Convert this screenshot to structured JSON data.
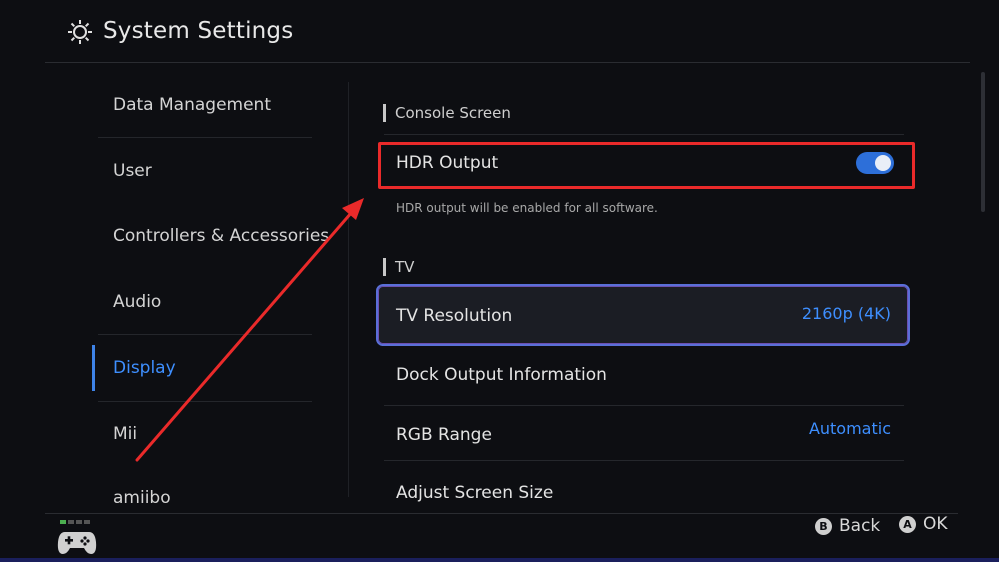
{
  "header": {
    "title": "System Settings",
    "icon": "gear-icon"
  },
  "sidebar": {
    "items": [
      {
        "label": "Data Management"
      },
      {
        "label": "User"
      },
      {
        "label": "Controllers & Accessories"
      },
      {
        "label": "Audio"
      },
      {
        "label": "Display",
        "selected": true
      },
      {
        "label": "Mii"
      },
      {
        "label": "amiibo"
      }
    ]
  },
  "content": {
    "console_section": "Console Screen",
    "hdr": {
      "label": "HDR Output",
      "enabled": true,
      "description": "HDR output will be enabled for all software."
    },
    "tv_section": "TV",
    "rows": [
      {
        "label": "TV Resolution",
        "value": "2160p (4K)"
      },
      {
        "label": "Dock Output Information",
        "value": ""
      },
      {
        "label": "RGB Range",
        "value": "Automatic"
      },
      {
        "label": "Adjust Screen Size",
        "value": ""
      }
    ]
  },
  "footer": {
    "back": {
      "glyph": "B",
      "label": "Back"
    },
    "ok": {
      "glyph": "A",
      "label": "OK"
    }
  },
  "colors": {
    "accent": "#3e8fff",
    "toggle_on": "#2d6fd9",
    "highlight_red": "#ea2a2a",
    "background": "#0d0e12"
  }
}
